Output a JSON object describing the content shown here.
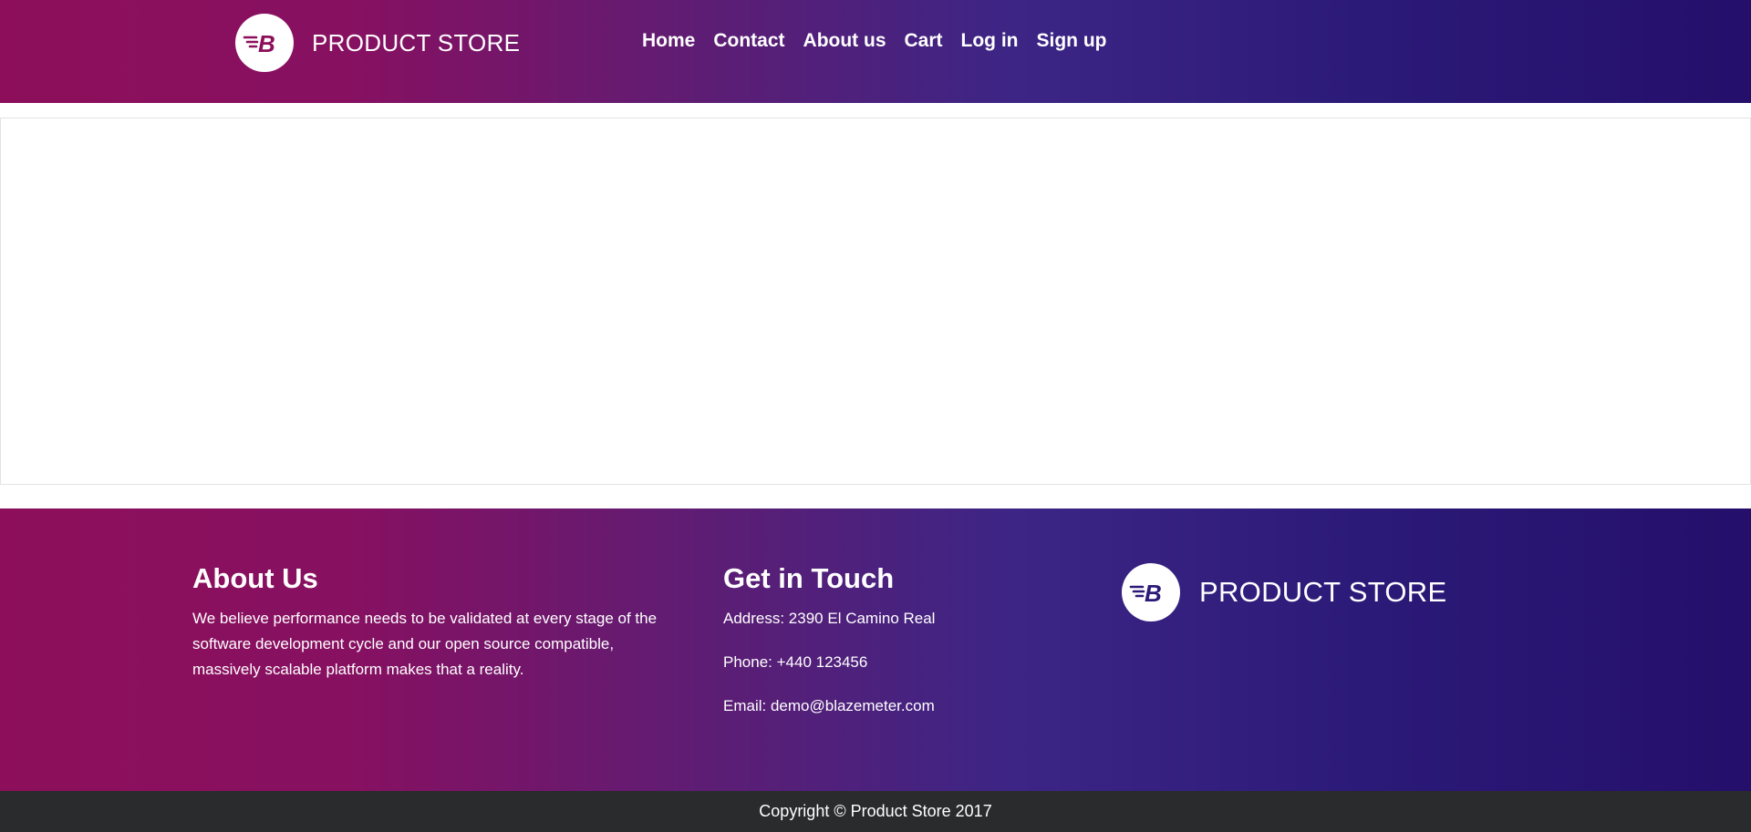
{
  "header": {
    "brand_name": "PRODUCT STORE",
    "logo_icon": "blazemeter-b-logo-icon",
    "nav_items": [
      {
        "label": "Home"
      },
      {
        "label": "Contact"
      },
      {
        "label": "About us"
      },
      {
        "label": "Cart"
      },
      {
        "label": "Log in"
      },
      {
        "label": "Sign up"
      }
    ]
  },
  "footer": {
    "about": {
      "title": "About Us",
      "text": "We believe performance needs to be validated at every stage of the software development cycle and our open source compatible, massively scalable platform makes that a reality."
    },
    "contact": {
      "title": "Get in Touch",
      "address": "Address: 2390 El Camino Real",
      "phone": "Phone: +440 123456",
      "email": "Email: demo@blazemeter.com"
    },
    "brand_name": "PRODUCT STORE",
    "copyright": "Copyright © Product Store 2017"
  },
  "colors": {
    "gradient_start": "#8d0f5b",
    "gradient_end": "#240f6b",
    "copyright_bar": "#2a2b2d"
  }
}
